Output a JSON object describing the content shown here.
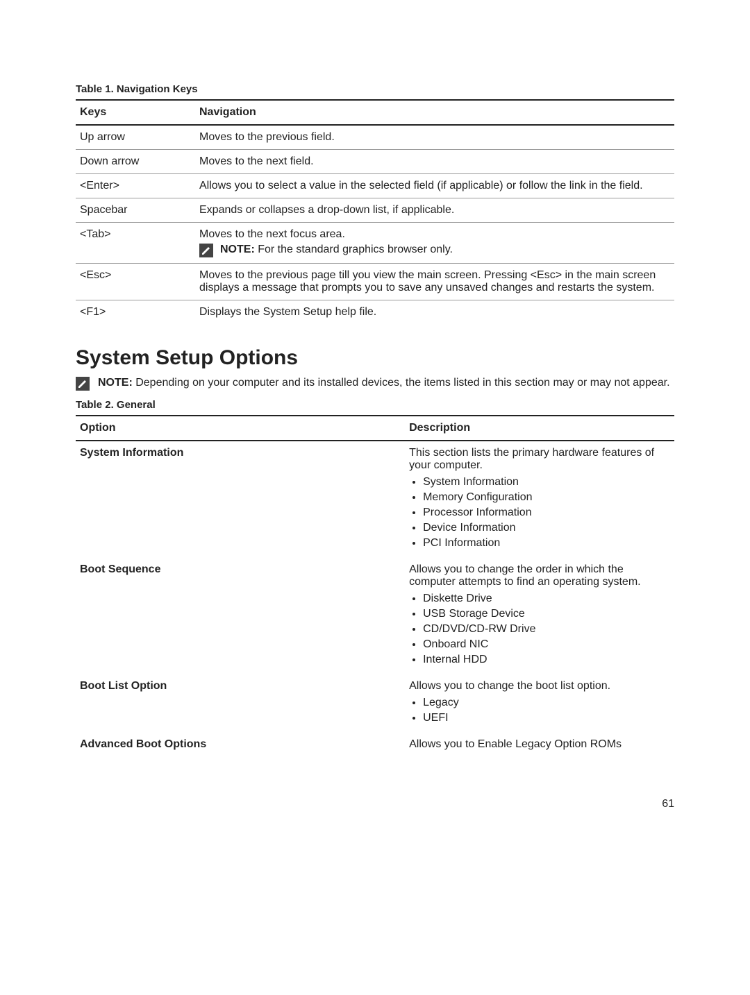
{
  "table1": {
    "caption": "Table 1. Navigation Keys",
    "head": {
      "keys": "Keys",
      "nav": "Navigation"
    },
    "rows": {
      "up": {
        "key": "Up arrow",
        "desc": "Moves to the previous field."
      },
      "down": {
        "key": "Down arrow",
        "desc": "Moves to the next field."
      },
      "enter": {
        "key": "<Enter>",
        "desc": "Allows you to select a value in the selected field (if applicable) or follow the link in the field."
      },
      "spacebar": {
        "key": "Spacebar",
        "desc": "Expands or collapses a drop-down list, if applicable."
      },
      "tab": {
        "key": "<Tab>",
        "desc": "Moves to the next focus area.",
        "note_label": "NOTE:",
        "note_text": " For the standard graphics browser only."
      },
      "esc": {
        "key": "<Esc>",
        "desc": "Moves to the previous page till you view the main screen. Pressing <Esc> in the main screen displays a message that prompts you to save any unsaved changes and restarts the system."
      },
      "f1": {
        "key": "<F1>",
        "desc": "Displays the System Setup help file."
      }
    }
  },
  "section": {
    "title": "System Setup Options",
    "note_label": "NOTE:",
    "note_text": " Depending on your computer and its installed devices, the items listed in this section may or may not appear."
  },
  "table2": {
    "caption": "Table 2. General",
    "head": {
      "option": "Option",
      "desc": "Description"
    },
    "rows": {
      "sysinfo": {
        "label": "System Information",
        "desc": "This section lists the primary hardware features of your computer.",
        "items": [
          "System Information",
          "Memory Configuration",
          "Processor Information",
          "Device Information",
          "PCI Information"
        ]
      },
      "bootseq": {
        "label": "Boot Sequence",
        "desc": "Allows you to change the order in which the computer attempts to find an operating system.",
        "items": [
          "Diskette Drive",
          "USB Storage Device",
          "CD/DVD/CD-RW Drive",
          "Onboard NIC",
          "Internal HDD"
        ]
      },
      "bootlist": {
        "label": "Boot List Option",
        "desc": "Allows you to change the boot list option.",
        "items": [
          "Legacy",
          "UEFI"
        ]
      },
      "advboot": {
        "label": "Advanced Boot Options",
        "desc": "Allows you to Enable Legacy Option ROMs"
      }
    }
  },
  "page_number": "61"
}
